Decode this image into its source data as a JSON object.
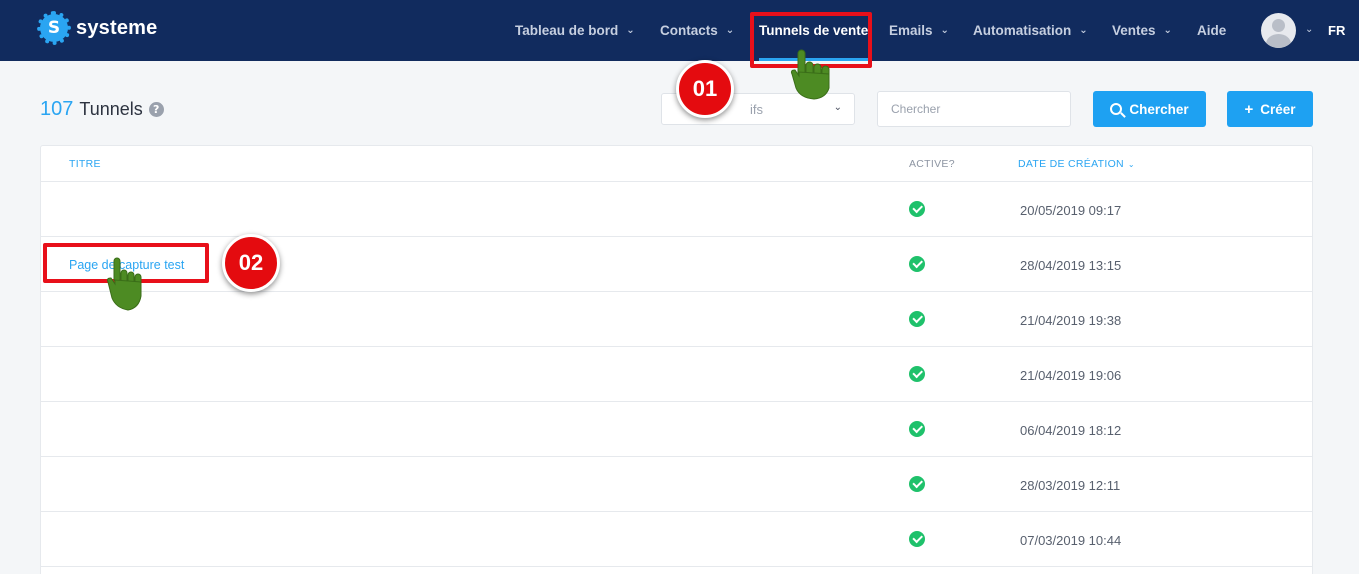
{
  "brand": {
    "name": "systeme",
    "badge_letter": "S"
  },
  "nav": {
    "items": [
      {
        "label": "Tableau de bord",
        "has_menu": true
      },
      {
        "label": "Contacts",
        "has_menu": true
      },
      {
        "label": "Tunnels de vente",
        "has_menu": false,
        "active": true
      },
      {
        "label": "Emails",
        "has_menu": true
      },
      {
        "label": "Automatisation",
        "has_menu": true
      },
      {
        "label": "Ventes",
        "has_menu": true
      },
      {
        "label": "Aide",
        "has_menu": false
      }
    ],
    "language": "FR"
  },
  "page": {
    "count": "107",
    "title": "Tunnels",
    "help_icon": "question-circle-icon"
  },
  "filters": {
    "status_visible_text": "ifs",
    "search_placeholder": "Chercher",
    "search_button": "Chercher",
    "create_button": "Créer"
  },
  "table": {
    "columns": {
      "title": "TITRE",
      "active": "ACTIVE?",
      "date": "DATE DE CRÉATION"
    },
    "rows": [
      {
        "title": "",
        "active": true,
        "date": "20/05/2019 09:17"
      },
      {
        "title": "Page de capture test",
        "active": true,
        "date": "28/04/2019 13:15"
      },
      {
        "title": "",
        "active": true,
        "date": "21/04/2019 19:38"
      },
      {
        "title": "",
        "active": true,
        "date": "21/04/2019 19:06"
      },
      {
        "title": "",
        "active": true,
        "date": "06/04/2019 18:12"
      },
      {
        "title": "",
        "active": true,
        "date": "28/03/2019 12:11"
      },
      {
        "title": "",
        "active": true,
        "date": "07/03/2019 10:44"
      }
    ]
  },
  "annotations": {
    "step_1": "01",
    "step_2": "02",
    "highlight_color": "#e8101a",
    "hand_color": "#4d8b23"
  },
  "colors": {
    "nav_bg": "#112b5e",
    "accent": "#1ea1f2",
    "success": "#1fc16b"
  }
}
